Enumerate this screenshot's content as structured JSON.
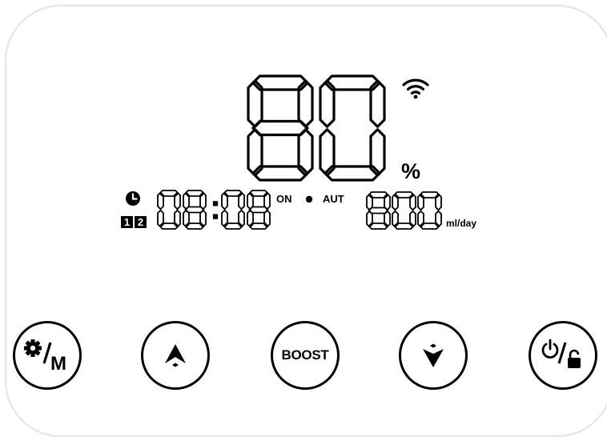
{
  "display": {
    "humidity_value": "80",
    "humidity_unit": "%",
    "wifi_icon": "wifi-icon",
    "clock_icon": "clock-icon",
    "timer_slots": [
      "1",
      "2"
    ],
    "time_value": "08:08",
    "on_label": "ON",
    "mode_dot": "•",
    "mode_label": "AUT",
    "flow_value": "800",
    "flow_unit": "ml/day"
  },
  "buttons": {
    "settings_mode": {
      "icon": "gear-icon",
      "label": "M"
    },
    "up": {
      "icon": "arrow-up-icon"
    },
    "boost": {
      "label": "BOOST"
    },
    "down": {
      "icon": "arrow-down-icon"
    },
    "power_lock": {
      "icon": "power-icon",
      "secondary_icon": "lock-icon"
    }
  },
  "colors": {
    "foreground": "#000000",
    "background": "#ffffff",
    "panel_border": "#e3e3e3"
  }
}
